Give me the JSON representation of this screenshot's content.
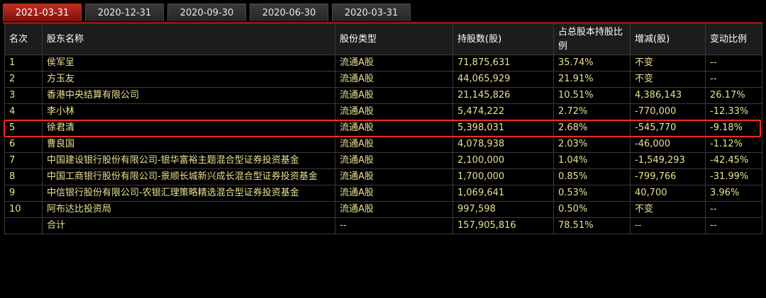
{
  "tabs": [
    "2021-03-31",
    "2020-12-31",
    "2020-09-30",
    "2020-06-30",
    "2020-03-31"
  ],
  "active_tab": 0,
  "columns": [
    "名次",
    "股东名称",
    "股份类型",
    "持股数(股)",
    "占总股本持股比例",
    "增减(股)",
    "变动比例"
  ],
  "rows": [
    [
      "1",
      "侯军呈",
      "流通A股",
      "71,875,631",
      "35.74%",
      "不变",
      "--"
    ],
    [
      "2",
      "方玉友",
      "流通A股",
      "44,065,929",
      "21.91%",
      "不变",
      "--"
    ],
    [
      "3",
      "香港中央结算有限公司",
      "流通A股",
      "21,145,826",
      "10.51%",
      "4,386,143",
      "26.17%"
    ],
    [
      "4",
      "李小林",
      "流通A股",
      "5,474,222",
      "2.72%",
      "-770,000",
      "-12.33%"
    ],
    [
      "5",
      "徐君清",
      "流通A股",
      "5,398,031",
      "2.68%",
      "-545,770",
      "-9.18%"
    ],
    [
      "6",
      "曹良国",
      "流通A股",
      "4,078,938",
      "2.03%",
      "-46,000",
      "-1.12%"
    ],
    [
      "7",
      "中国建设银行股份有限公司-银华富裕主题混合型证券投资基金",
      "流通A股",
      "2,100,000",
      "1.04%",
      "-1,549,293",
      "-42.45%"
    ],
    [
      "8",
      "中国工商银行股份有限公司-景顺长城新兴成长混合型证券投资基金",
      "流通A股",
      "1,700,000",
      "0.85%",
      "-799,766",
      "-31.99%"
    ],
    [
      "9",
      "中信银行股份有限公司-农银汇理策略精选混合型证券投资基金",
      "流通A股",
      "1,069,641",
      "0.53%",
      "40,700",
      "3.96%"
    ],
    [
      "10",
      "阿布达比投资局",
      "流通A股",
      "997,598",
      "0.50%",
      "不变",
      "--"
    ],
    [
      "",
      "合计",
      "--",
      "157,905,816",
      "78.51%",
      "--",
      "--"
    ]
  ],
  "highlighted_row": 4,
  "colors": {
    "active_tab": "#c22d1f",
    "cell_text": "#e8e090",
    "highlight_border": "#ff2a1f"
  }
}
